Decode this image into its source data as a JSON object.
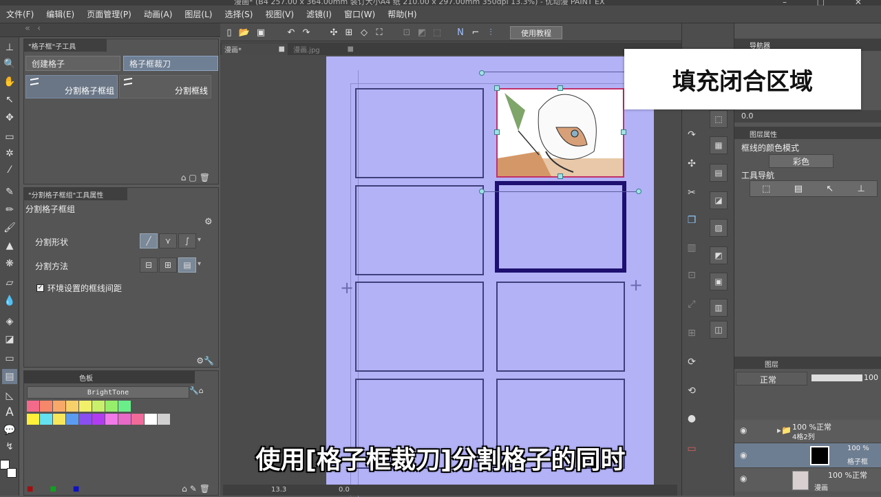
{
  "titlebar": {
    "text": "漫画* (B4 257.00 x 364.00mm 装订大小A4 纸 210.00 x 297.00mm 350dpi 13.3%) - 优动漫 PAINT EX"
  },
  "menu": [
    "文件(F)",
    "编辑(E)",
    "页面管理(P)",
    "动画(A)",
    "图层(L)",
    "选择(S)",
    "视图(V)",
    "滤镜(I)",
    "窗口(W)",
    "帮助(H)"
  ],
  "subtool": {
    "panel_tab": "\"格子框\"子工具",
    "tabs": [
      "创建格子",
      "格子框裁刀"
    ],
    "items": [
      "分割格子框组",
      "分割框线"
    ]
  },
  "tool_property": {
    "panel_tab": "\"分割格子框组\"工具属性",
    "title": "分割格子框组",
    "split_shape_label": "分割形状",
    "split_method_label": "分割方法",
    "env_checkbox_label": "环境设置的框线间距"
  },
  "palette": {
    "tab": "色板",
    "name": "BrightTone"
  },
  "canvas": {
    "tutorial_button": "使用教程",
    "doc_tabs": [
      "漫画*",
      "漫画.jpg"
    ],
    "zoom": "13.3",
    "rotation": "0.0"
  },
  "right_panel": {
    "navigator_tab": "导航器",
    "nav_value": "0.0",
    "layer_property_tab": "图层属性",
    "frame_color_mode_label": "框线的颜色模式",
    "color_mode": "彩色",
    "tool_nav_label": "工具导航",
    "layers_tab": "图层",
    "blend_mode": "正常",
    "opacity": "100",
    "layers": [
      {
        "line1": "100 %正常",
        "line2": "4格2列"
      },
      {
        "line1": "100 %",
        "line2": "格子框"
      },
      {
        "line1": "100 %正常",
        "line2": "漫画"
      }
    ]
  },
  "overlay": {
    "title_card": "填充闭合区域",
    "subtitle": "使用[格子框裁刀]分割格子的同时"
  },
  "colors": {
    "page": "#b3b2f7",
    "frame_border": "#3f3e7a",
    "selected_frame": "#1d1070",
    "panel_bg": "#555555"
  },
  "palette_swatches": [
    "#f36a8a",
    "#f7876a",
    "#f8a96a",
    "#f8d06a",
    "#f2f06a",
    "#c9f06a",
    "#97ee6a",
    "#6aee8a",
    "#ffef3b",
    "#64e0f0",
    "#f7e65a",
    "#5b9cf2",
    "#8a4ff0",
    "#b23df0",
    "#f07ae8",
    "#e869c8",
    "#f06a9a",
    "#ffffff",
    "#d0d0d0"
  ]
}
